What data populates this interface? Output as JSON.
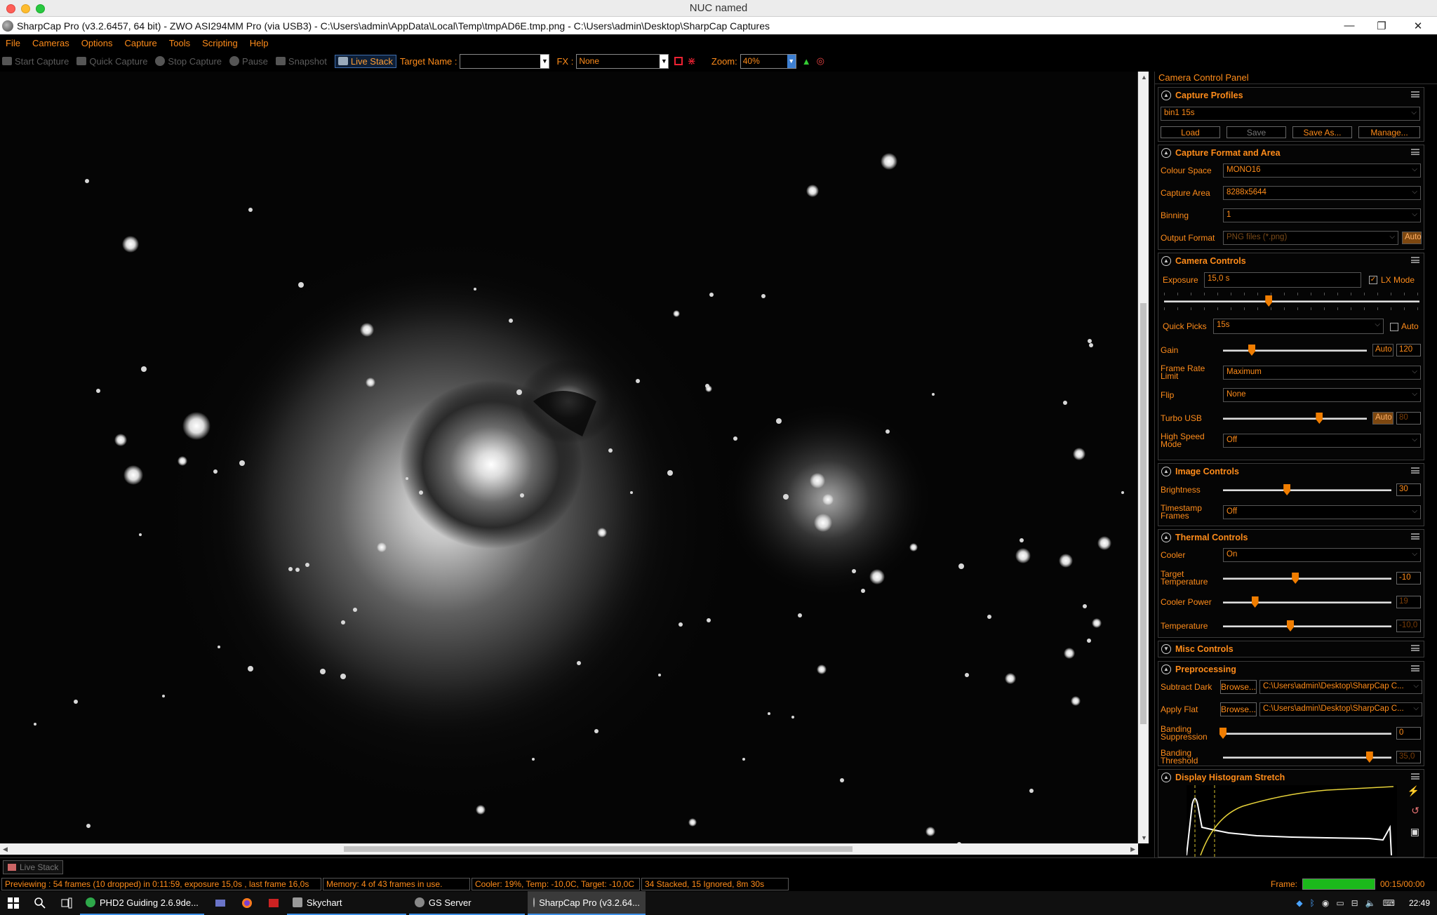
{
  "mac_title": "NUC named",
  "window": {
    "title": "SharpCap Pro (v3.2.6457, 64 bit) - ZWO ASI294MM Pro (via USB3) - C:\\Users\\admin\\AppData\\Local\\Temp\\tmpAD6E.tmp.png - C:\\Users\\admin\\Desktop\\SharpCap Captures",
    "minimize": "—",
    "restore": "❐",
    "close": "✕"
  },
  "menu": [
    "File",
    "Cameras",
    "Options",
    "Capture",
    "Tools",
    "Scripting",
    "Help"
  ],
  "toolbar": {
    "start_capture": "Start Capture",
    "quick_capture": "Quick Capture",
    "stop_capture": "Stop Capture",
    "pause": "Pause",
    "snapshot": "Snapshot",
    "live_stack": "Live Stack",
    "target_name_label": "Target Name :",
    "target_name_value": "",
    "fx_label": "FX :",
    "fx_value": "None",
    "zoom_label": "Zoom:",
    "zoom_value": "40%"
  },
  "panel": {
    "title": "Camera Control Panel",
    "capture_profiles": {
      "header": "Capture Profiles",
      "profile": "bin1 15s",
      "load": "Load",
      "save": "Save",
      "save_as": "Save As...",
      "manage": "Manage..."
    },
    "capture_format": {
      "header": "Capture Format and Area",
      "colour_space_label": "Colour Space",
      "colour_space": "MONO16",
      "capture_area_label": "Capture Area",
      "capture_area": "8288x5644",
      "binning_label": "Binning",
      "binning": "1",
      "output_format_label": "Output Format",
      "output_format": "PNG files (*.png)",
      "auto": "Auto"
    },
    "camera_controls": {
      "header": "Camera Controls",
      "exposure_label": "Exposure",
      "exposure": "15,0 s",
      "lx_mode": "LX Mode",
      "lx_mode_checked": true,
      "exposure_level": 0.41,
      "quick_picks_label": "Quick Picks",
      "quick_picks": "15s",
      "quick_auto": "Auto",
      "gain_label": "Gain",
      "gain_auto": "Auto",
      "gain": "120",
      "gain_level": 0.2,
      "frame_rate_label": "Frame Rate Limit",
      "frame_rate": "Maximum",
      "flip_label": "Flip",
      "flip": "None",
      "turbo_label": "Turbo USB",
      "turbo_auto": "Auto",
      "turbo": "80",
      "turbo_level": 0.67,
      "high_speed_label": "High Speed Mode",
      "high_speed": "Off"
    },
    "image_controls": {
      "header": "Image Controls",
      "brightness_label": "Brightness",
      "brightness": "30",
      "brightness_level": 0.38,
      "timestamp_label": "Timestamp Frames",
      "timestamp": "Off"
    },
    "thermal": {
      "header": "Thermal Controls",
      "cooler_label": "Cooler",
      "cooler": "On",
      "target_label": "Target Temperature",
      "target": "-10",
      "target_level": 0.43,
      "power_label": "Cooler Power",
      "power": "19",
      "power_level": 0.19,
      "temp_label": "Temperature",
      "temp": "-10,0",
      "temp_level": 0.4
    },
    "misc": {
      "header": "Misc Controls"
    },
    "preprocessing": {
      "header": "Preprocessing",
      "dark_label": "Subtract Dark",
      "browse": "Browse...",
      "dark_path": "C:\\Users\\admin\\Desktop\\SharpCap C...",
      "flat_label": "Apply Flat",
      "flat_path": "C:\\Users\\admin\\Desktop\\SharpCap C...",
      "banding_sup_label": "Banding Suppression",
      "banding_sup": "0",
      "banding_sup_level": 0.0,
      "banding_thr_label": "Banding Threshold",
      "banding_thr": "35,0",
      "banding_thr_level": 0.87
    },
    "histogram": {
      "header": "Display Histogram Stretch"
    }
  },
  "bottom": {
    "tab": "Live Stack",
    "status_preview": "Previewing : 54 frames (10 dropped) in 0:11:59, exposure 15,0s , last frame 16,0s",
    "status_memory": "Memory: 4 of 43 frames in use.",
    "status_cooler": "Cooler: 19%, Temp: -10,0C, Target: -10,0C",
    "status_stack": "34 Stacked, 15 Ignored, 8m 30s",
    "frame_label": "Frame:",
    "frame_time": "00:15/00:00",
    "frame_progress": 1.0
  },
  "taskbar": {
    "apps": [
      "PHD2 Guiding 2.6.9de...",
      "Skychart",
      "GS Server",
      "SharpCap Pro (v3.2.64..."
    ],
    "time": "22:49"
  },
  "colors": {
    "accent": "#ff8c1a",
    "frame_progress": "#1bb91b",
    "live_stack_border": "#3f6fb0"
  }
}
